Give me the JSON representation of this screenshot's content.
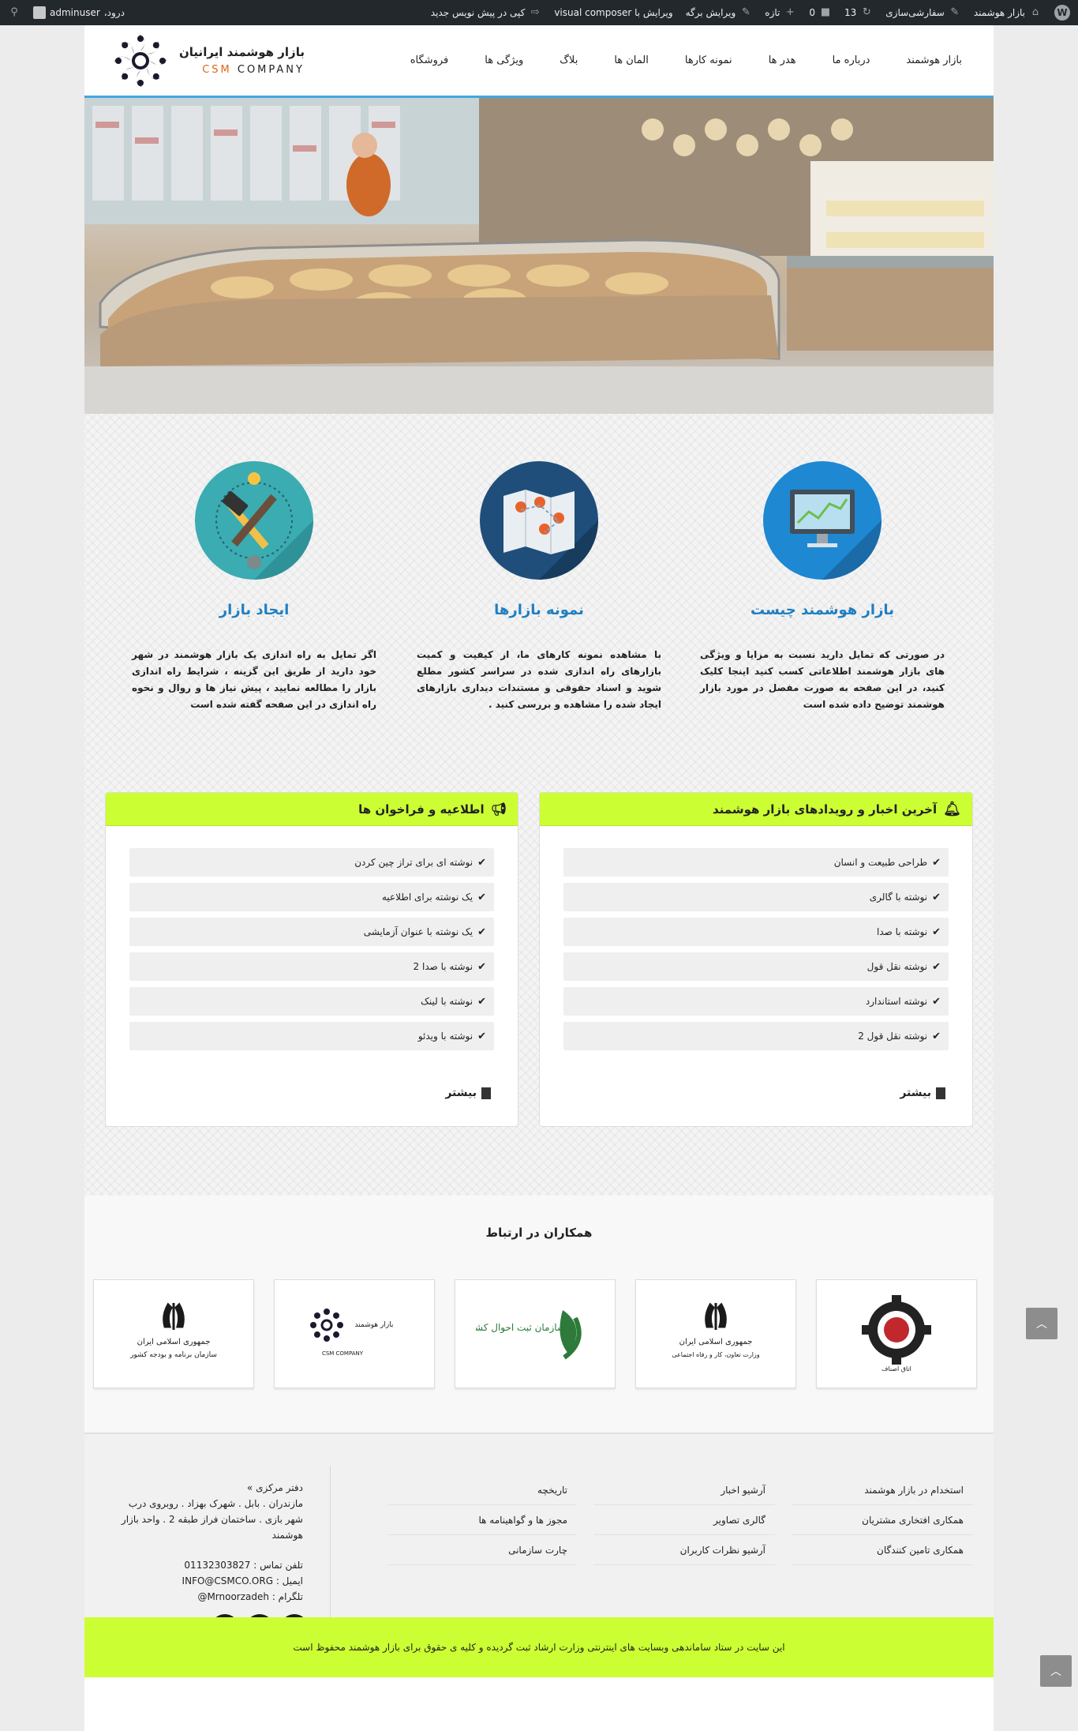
{
  "adminbar": {
    "site_name": "بازار هوشمند",
    "customize": "سفارشی‌سازی",
    "updates_count": "13",
    "comments_count": "0",
    "new_label": "تازه",
    "edit_page": "ویرایش برگه",
    "vc_label": "ویرایش با visual composer",
    "copy_draft": "کپی در پیش نویس جدید",
    "greeting": "درود،",
    "username": "adminuser"
  },
  "header": {
    "nav": [
      "بازار هوشمند",
      "درباره ما",
      "هدر ها",
      "نمونه کارها",
      "المان ها",
      "بلاگ",
      "ویژگی ها",
      "فروشگاه"
    ],
    "brand_name": "بازار هوشمند ایرانیان",
    "brand_csm": "CSM",
    "brand_company": "COMPANY"
  },
  "features": [
    {
      "title": "بازار هوشمند چیست",
      "icon": "monitor-chart-icon",
      "color": "#1e88d2",
      "text": "در صورتی که تمایل دارید نسبت به مزایا و ویژگی های بازار هوشمند اطلاعاتی کسب کنید اینجا کلیک کنید، در این صفحه به صورت مفصل در مورد بازار هوشمند توضیح داده شده است"
    },
    {
      "title": "نمونه بازارها",
      "icon": "map-pins-icon",
      "color": "#1f4e7a",
      "text": "با مشاهده نمونه کارهای ما، از کیفیت و کمیت بازارهای راه اندازی شده در سراسر کشور مطلع شوید و اسناد حقوقی و مستندات دیداری بازارهای ایجاد شده را مشاهده و بررسی کنید ."
    },
    {
      "title": "ایجاد بازار",
      "icon": "hammer-pencil-icon",
      "color": "#3aacb2",
      "text": "اگر تمایل به راه اندازی یک بازار هوشمند در شهر خود دارید از طریق این گزینه ، شرایط راه اندازی بازار را مطالعه نمایید ، پیش نیاز ها و روال و نحوه راه اندازی در این صفحه گفته شده است"
    }
  ],
  "news_panel": {
    "title": "آخرین اخبار و رویدادهای بازار هوشمند",
    "items": [
      "طراحی طبیعت و انسان",
      "نوشته با گالری",
      "نوشته با صدا",
      "نوشته نقل قول",
      "نوشته استاندارد",
      "نوشته نقل قول 2"
    ],
    "more": "بیشتر"
  },
  "notice_panel": {
    "title": "اطلاعیه و فراخوان ها",
    "items": [
      "نوشته ای برای تراز چین کردن",
      "یک نوشته برای اطلاعیه",
      "یک نوشته با عنوان آزمایشی",
      "نوشته با صدا 2",
      "نوشته با لینک",
      "نوشته با ویدئو"
    ],
    "more": "بیشتر"
  },
  "partners": {
    "title": "همکاران در ارتباط",
    "logos": [
      {
        "name": "logo-gear-emblem",
        "caption": "اتاق اصناف"
      },
      {
        "name": "logo-ministry-labor",
        "caption": "جمهوری اسلامی ایران",
        "sub": "وزارت تعاون، کار و رفاه اجتماعی"
      },
      {
        "name": "logo-civil-registry",
        "caption": "سازمان ثبت احوال کشور"
      },
      {
        "name": "logo-csm",
        "caption": "بازار هوشمند",
        "sub": "CSM COMPANY"
      },
      {
        "name": "logo-plan-org",
        "caption": "جمهوری اسلامی ایران",
        "sub": "سازمان برنامه و بودجه کشور"
      }
    ]
  },
  "footer": {
    "col1": [
      "استخدام در بازار هوشمند",
      "همکاری افتخاری مشتریان",
      "همکاری تامین کنندگان"
    ],
    "col2": [
      "آرشیو اخبار",
      "گالری تصاویر",
      "آرشیو نظرات کاربران"
    ],
    "col3": [
      "تاریخچه",
      "مجوز ها و گواهینامه ها",
      "چارت سازمانی"
    ],
    "office_title": "دفتر مرکزی »",
    "address": "مازندران . بابل . شهرک بهزاد . روبروی درب شهر بازی . ساختمان فراز طبقه 2 . واحد بازار هوشمند",
    "phone": "تلفن تماس : 01132303827",
    "email": "ایمیل : INFO@CSMCO.ORG",
    "telegram": "تلگرام : Mrnoorzadeh@",
    "social_icons": [
      "twitter-icon",
      "telegram-icon",
      "instagram-icon"
    ]
  },
  "copyright": "این سایت در ستاد ساماندهی وبسایت های اینترنتی وزارت ارشاد ثبت گردیده و کلیه ی حقوق برای بازار هوشمند محفوظ است"
}
